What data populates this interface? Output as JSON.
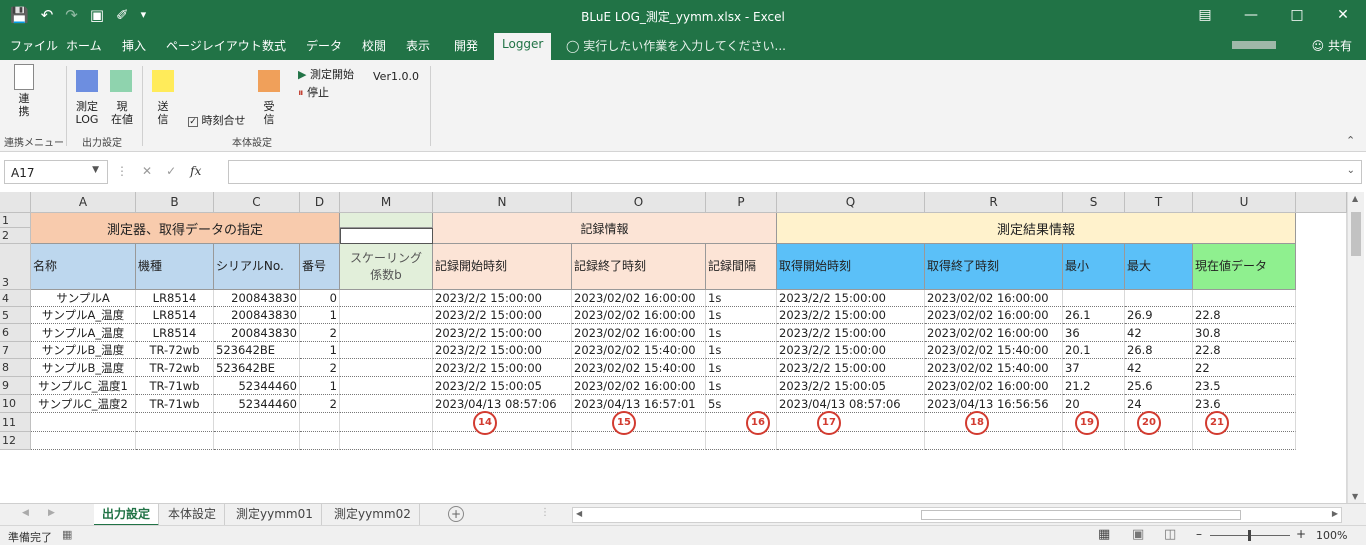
{
  "window": {
    "title": "BLuE LOG_測定_yymm.xlsx - Excel",
    "quick_access": [
      "save-icon",
      "undo-icon",
      "redo-icon",
      "camera-icon",
      "brush-icon",
      "customize-icon"
    ],
    "buttons": [
      "ribbon-display-icon",
      "minimize-icon",
      "maximize-icon",
      "close-icon"
    ]
  },
  "tabs": [
    "ファイル",
    "ホーム",
    "挿入",
    "ページレイアウト",
    "数式",
    "データ",
    "校閲",
    "表示",
    "開発",
    "Logger"
  ],
  "tell_me": "実行したい作業を入力してください...",
  "share": "共有",
  "ribbon": {
    "renkei": "連携",
    "sokutei_log": "測定\nLOG",
    "genzaichi": "現\n在値",
    "soshin": "送\n信",
    "jikoku": "時刻合せ",
    "jushin": "受\n信",
    "start": "測定開始",
    "stop": "停止",
    "version": "Ver1.0.0",
    "groups": [
      "連携メニュー",
      "出力設定",
      "本体設定"
    ]
  },
  "formula_bar": {
    "name_box": "A17",
    "fx": "fx",
    "formula": ""
  },
  "columns": [
    "A",
    "B",
    "C",
    "D",
    "M",
    "N",
    "O",
    "P",
    "Q",
    "R",
    "S",
    "T",
    "U"
  ],
  "rows": [
    "1",
    "2",
    "3",
    "4",
    "5",
    "6",
    "7",
    "8",
    "9",
    "10",
    "11",
    "12"
  ],
  "header_groups": {
    "g1": "測定器、取得データの指定",
    "g2": "記録情報",
    "g3": "測定結果情報"
  },
  "headers": [
    "名称",
    "機種",
    "シリアルNo.",
    "番号",
    "スケーリング\n係数b",
    "記録開始時刻",
    "記録終了時刻",
    "記録間隔",
    "取得開始時刻",
    "取得終了時刻",
    "最小",
    "最大",
    "現在値データ"
  ],
  "data_rows": [
    [
      "サンプルA",
      "LR8514",
      "200843830",
      "0",
      "",
      "2023/2/2 15:00:00",
      "2023/02/02 16:00:00",
      "1s",
      "2023/2/2 15:00:00",
      "2023/02/02 16:00:00",
      "",
      "",
      ""
    ],
    [
      "サンプルA_温度",
      "LR8514",
      "200843830",
      "1",
      "",
      "2023/2/2 15:00:00",
      "2023/02/02 16:00:00",
      "1s",
      "2023/2/2 15:00:00",
      "2023/02/02 16:00:00",
      "26.1",
      "26.9",
      "22.8"
    ],
    [
      "サンプルA_温度",
      "LR8514",
      "200843830",
      "2",
      "",
      "2023/2/2 15:00:00",
      "2023/02/02 16:00:00",
      "1s",
      "2023/2/2 15:00:00",
      "2023/02/02 16:00:00",
      "36",
      "42",
      "30.8"
    ],
    [
      "サンプルB_温度",
      "TR-72wb",
      "523642BE",
      "1",
      "",
      "2023/2/2 15:00:00",
      "2023/02/02 15:40:00",
      "1s",
      "2023/2/2 15:00:00",
      "2023/02/02 15:40:00",
      "20.1",
      "26.8",
      "22.8"
    ],
    [
      "サンプルB_温度",
      "TR-72wb",
      "523642BE",
      "2",
      "",
      "2023/2/2 15:00:00",
      "2023/02/02 15:40:00",
      "1s",
      "2023/2/2 15:00:00",
      "2023/02/02 15:40:00",
      "37",
      "42",
      "22"
    ],
    [
      "サンプルC_温度1",
      "TR-71wb",
      "52344460",
      "1",
      "",
      "2023/2/2 15:00:05",
      "2023/02/02 16:00:00",
      "1s",
      "2023/2/2 15:00:05",
      "2023/02/02 16:00:00",
      "21.2",
      "25.6",
      "23.5"
    ],
    [
      "サンプルC_温度2",
      "TR-71wb",
      "52344460",
      "2",
      "",
      "2023/04/13 08:57:06",
      "2023/04/13 16:57:01",
      "5s",
      "2023/04/13 08:57:06",
      "2023/04/13 16:56:56",
      "20",
      "24",
      "23.6"
    ]
  ],
  "markers": [
    "14",
    "15",
    "16",
    "17",
    "18",
    "19",
    "20",
    "21"
  ],
  "sheet_tabs": [
    "出力設定",
    "本体設定",
    "測定yymm01",
    "測定yymm02"
  ],
  "status": {
    "ready": "準備完了",
    "zoom": "100%"
  },
  "colors": {
    "excel_green": "#217346",
    "group1_fill": "#f8cbad",
    "group2_fill": "#fce4d6",
    "group3_fill": "#fff2cc",
    "name_header_fill": "#bdd7ee",
    "scaling_fill": "#e2efda",
    "acquire_header_fill": "#5bc0f8",
    "current_header_fill": "#8ff08f",
    "marker": "#d23b30"
  }
}
